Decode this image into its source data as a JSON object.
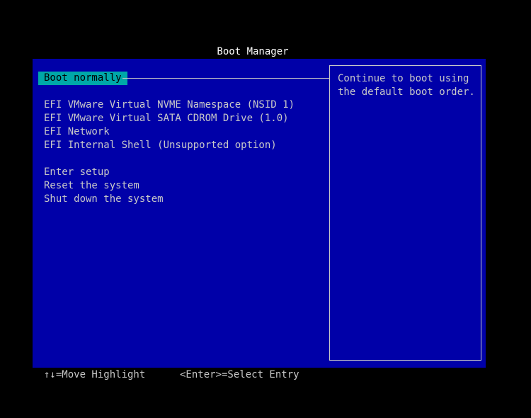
{
  "title": "Boot Manager",
  "colors": {
    "screen_bg": "#000000",
    "panel_bg": "#0000a8",
    "highlight_bg": "#00a8a8",
    "text": "#c8c8c8",
    "title_text": "#ffffff"
  },
  "menu": {
    "selected_index": 0,
    "items": [
      {
        "label": "Boot normally"
      },
      {
        "label": "EFI VMware Virtual NVME Namespace (NSID 1)"
      },
      {
        "label": "EFI VMware Virtual SATA CDROM Drive (1.0)"
      },
      {
        "label": "EFI Network"
      },
      {
        "label": "EFI Internal Shell (Unsupported option)"
      },
      {
        "label": "Enter setup"
      },
      {
        "label": "Reset the system"
      },
      {
        "label": "Shut down the system"
      }
    ]
  },
  "help": {
    "lines": [
      "Continue to boot using",
      "the default boot order."
    ]
  },
  "footer": {
    "move_hint": "↑↓=Move Highlight",
    "select_hint": "<Enter>=Select Entry"
  }
}
